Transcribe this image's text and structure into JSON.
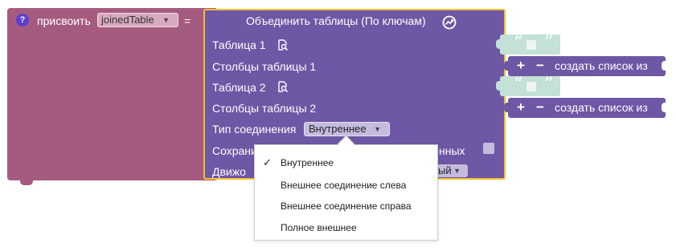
{
  "assign": {
    "help_icon": "?",
    "label": "присвоить",
    "variable": "joinedTable",
    "equals": "="
  },
  "join": {
    "title": "Объединить таблицы (По ключам)",
    "title_icon": "chart-icon",
    "table1_label": "Таблица 1",
    "cols1_label": "Столбцы таблицы 1",
    "table2_label": "Таблица 2",
    "cols2_label": "Столбцы таблицы 2",
    "jointype_label": "Тип соединения",
    "jointype_value": "Внутреннее",
    "keep_label_visible": "Сохрани",
    "keep_label_tail": "нных",
    "engine_label_visible": "Движо",
    "engine_value_visible": "ый"
  },
  "text_block": {
    "open_quote": "“",
    "close_quote": "”"
  },
  "list_block": {
    "plus": "+",
    "minus": "−",
    "label": "создать список из"
  },
  "menu": {
    "items": [
      {
        "label": "Внутреннее",
        "checked": "✓"
      },
      {
        "label": "Внешнее соединение слева",
        "checked": ""
      },
      {
        "label": "Внешнее соединение справа",
        "checked": ""
      },
      {
        "label": "Полное внешнее",
        "checked": ""
      }
    ]
  },
  "colors": {
    "assign_block": "#a55b80",
    "join_block": "#6e57a5",
    "highlight": "#f4be2c",
    "text_block": "#c3e1d6"
  }
}
